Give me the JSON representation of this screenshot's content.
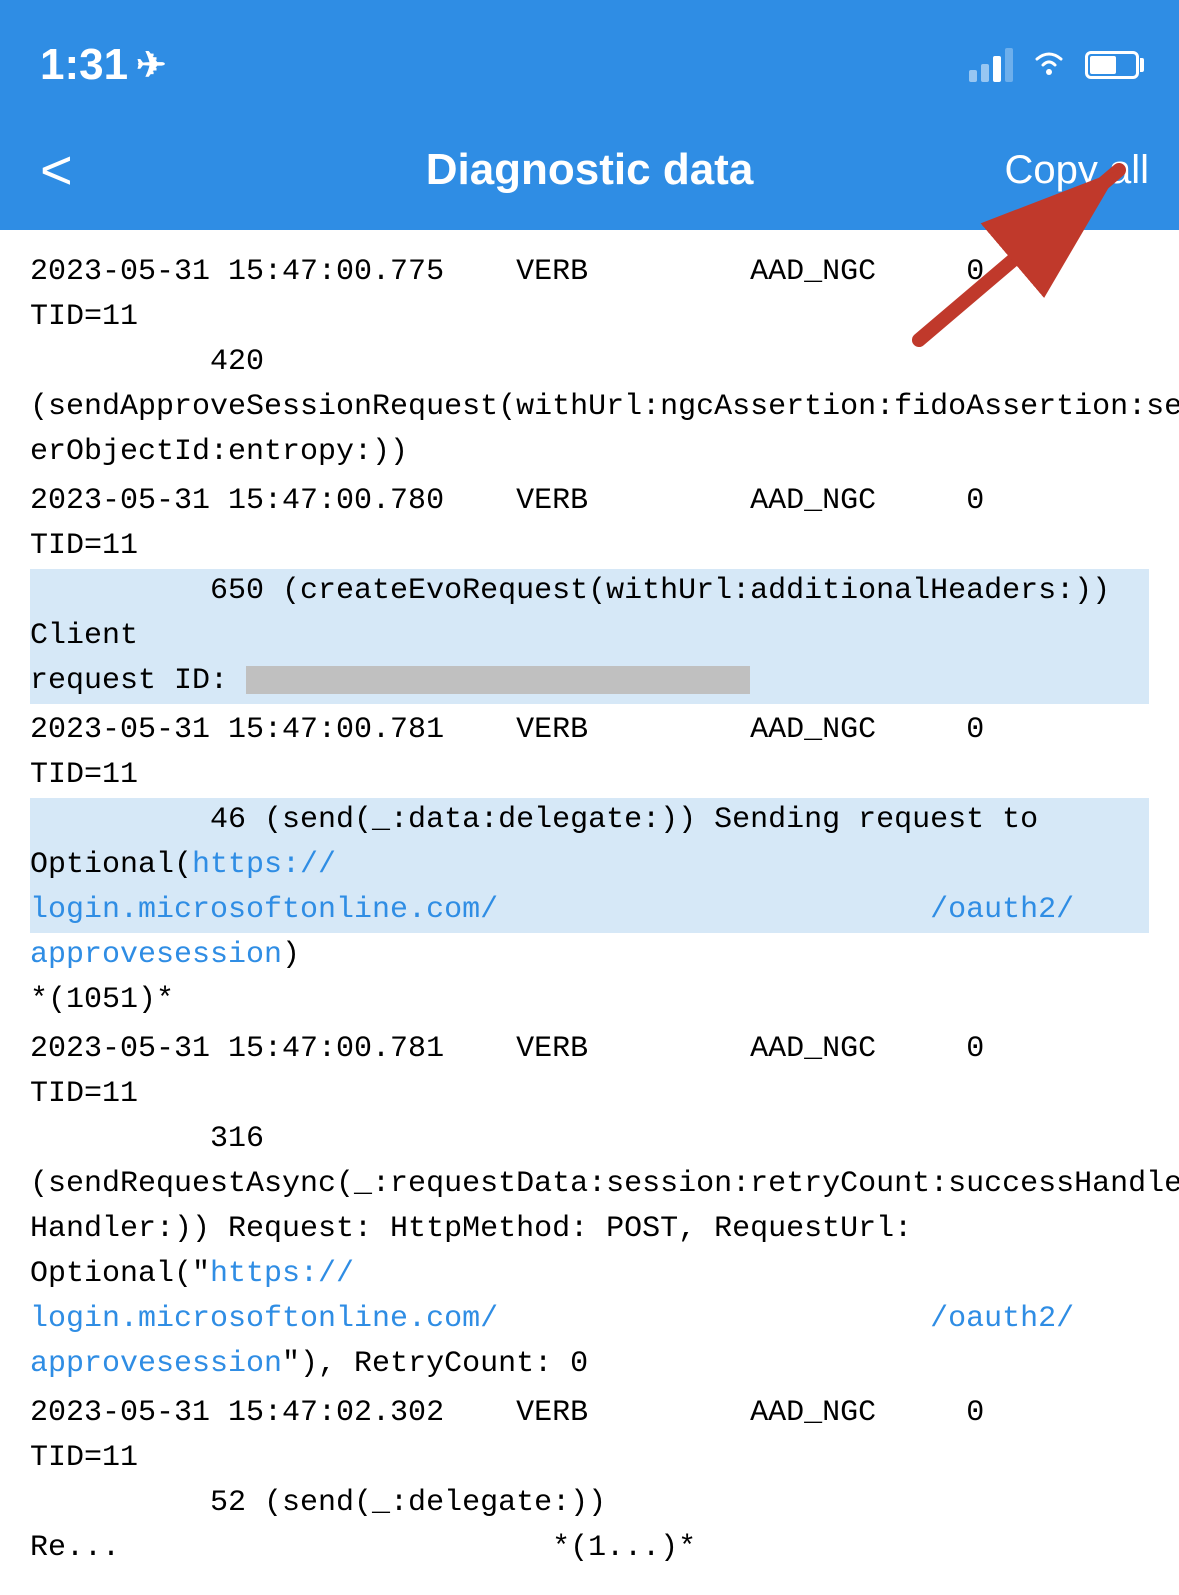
{
  "statusBar": {
    "time": "1:31",
    "locationIcon": "▶"
  },
  "navBar": {
    "backLabel": "<",
    "title": "Diagnostic data",
    "copyAllLabel": "Copy all"
  },
  "logs": [
    {
      "id": "log1",
      "timestamp": "2023-05-31 15:47:00.775",
      "level": "VERB",
      "component": "AAD_NGC",
      "code": "0",
      "tid": "TID=11",
      "continuation": "420",
      "message": "(sendApproveSessionRequest(withUrl:ngcAssertion:fidoAssertion:session:userObjectId:entropy:))",
      "hasRedacted": false,
      "hasLink": false
    },
    {
      "id": "log2",
      "timestamp": "2023-05-31 15:47:00.780",
      "level": "VERB",
      "component": "AAD_NGC",
      "code": "0",
      "tid": "TID=11",
      "continuation": "650",
      "message": "(createEvoRequest(withUrl:additionalHeaders:)) Client request ID:",
      "hasRedacted": true,
      "redactedPlaceholder": "",
      "hasLink": false,
      "highlighted": true
    },
    {
      "id": "log3",
      "timestamp": "2023-05-31 15:47:00.781",
      "level": "VERB",
      "component": "AAD_NGC",
      "code": "0",
      "tid": "TID=11",
      "continuation": "46",
      "messagePre": "(send(_:data:delegate:)) Sending request to Optional(",
      "linkText": "https://login.microsoftonline.com/oauth2/approvesession",
      "messagePost": ")",
      "extra": "*(1051)*",
      "hasLink": true,
      "highlighted": true
    },
    {
      "id": "log4",
      "timestamp": "2023-05-31 15:47:00.781",
      "level": "VERB",
      "component": "AAD_NGC",
      "code": "0",
      "tid": "TID=11",
      "continuation": "316",
      "messagePre": "(sendRequestAsync(_:requestData:session:retryCount:successHandler:errorHandler:)) Request: HttpMethod: POST, RequestUrl: Optional(\"",
      "linkText": "https://login.microsoftonline.com/oauth2/approvesession",
      "messagePost": "\"), RetryCount: 0",
      "hasLink": true
    },
    {
      "id": "log5",
      "timestamp": "2023-05-31 15:47:02.302",
      "level": "VERB",
      "component": "AAD_NGC",
      "code": "0",
      "tid": "TID=11",
      "continuation": "52",
      "message": "(send(_:delegate:)) Re...",
      "hasLink": false,
      "truncated": true
    }
  ],
  "arrow": {
    "color": "#c0392b"
  }
}
